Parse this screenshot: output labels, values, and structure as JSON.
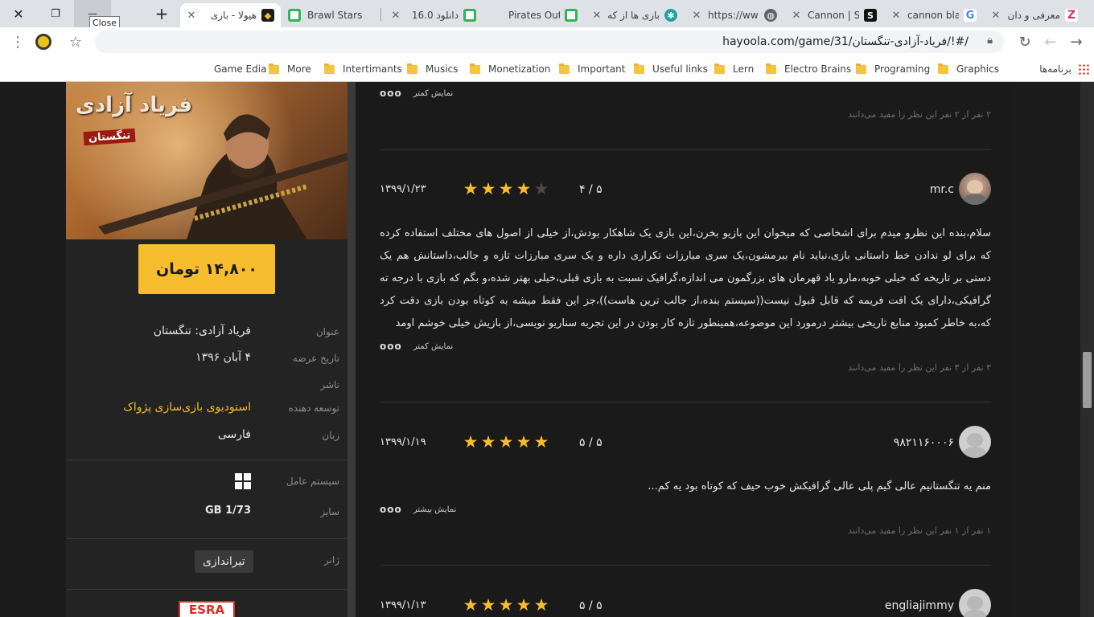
{
  "browser": {
    "window_controls": {
      "close": "✕",
      "restore": "❐",
      "minimize": "—",
      "new_tab": "+"
    },
    "tooltip": "Close",
    "tabs": [
      {
        "title": "هیولا - بازی",
        "icon": "hayoola-favicon",
        "active": true
      },
      {
        "title": "Brawl Stars",
        "icon": "d-favicon"
      },
      {
        "title": "دانلود 16.0",
        "icon": "d-favicon"
      },
      {
        "title": "Pirates Out",
        "icon": "d-favicon"
      },
      {
        "title": "بازی ها از که",
        "icon": "gear-favicon"
      },
      {
        "title": "https://ww",
        "icon": "globe-icon"
      },
      {
        "title": "Cannon | Sc",
        "icon": "s-favicon"
      },
      {
        "title": "cannon bla",
        "icon": "google-icon"
      },
      {
        "title": "معرفی و دان",
        "icon": "z-favicon"
      }
    ],
    "url": "hayoola.com/game/31/فریاد-آزادی-تنگستان/!#/",
    "bookmarks": [
      "برنامه‌ها",
      "Graphics",
      "Programing",
      "Electro Brains",
      "Lern",
      "Useful links",
      "Important",
      "Monetization",
      "Musics",
      "Intertimants",
      "More",
      "Game Edia"
    ]
  },
  "game": {
    "cover_title": "فریاد آزادی",
    "cover_subtitle": "تنگستان",
    "price": "۱۴,۸۰۰ تومان",
    "info": [
      {
        "label": "عنوان",
        "value": "فریاد آزادی: تنگستان"
      },
      {
        "label": "تاریخ عرضه",
        "value": "۴ آبان ۱۳۹۶"
      },
      {
        "label": "ناشر",
        "value": ""
      },
      {
        "label": "توسعه دهنده",
        "value": "استودیوی بازی‌سازی پژواک"
      },
      {
        "label": "زبان",
        "value": "فارسی"
      }
    ],
    "os_label": "سیستم عامل",
    "size_label": "سایز",
    "size_value": "1/73 GB",
    "genre_label": "ژانر",
    "genre": "تیراندازی",
    "rating_logo": "ESRA"
  },
  "reviews": {
    "dots": "ooo",
    "top_more": "نمایش کمتر",
    "top_helpful": "۲ نفر از ۲ نفر این نظر را مفید می‌دانند",
    "items": [
      {
        "user": "mr.c",
        "score": "۴ / ۵",
        "stars": 4,
        "date": "۱۳۹۹/۱/۲۳",
        "text": "سلام،بنده این نظرو میدم برای اشخاصی که میخوان این بازیو بخرن،این بازی یک شاهکار بودش،از خیلی از اصول های مختلف استفاده کرده که برای لو ندادن خط داستانی بازی،نباید نام ببرمشون،یک سری مبارزات تکراری داره و یک سری مبارزات تازه و جالب،داستانش هم یک دستی بر تاریخه که خیلی خوبه،مارو یاد قهرمان های بزرگمون می اندازه،گرافیک نسبت به بازی قبلی،خیلی بهتر شده،و بگم که بازی با درجه ته گرافیکی،دارای یک افت فریمه که قابل قبول نیست((سیستم بنده،از جالب ترین هاست))،جز این فقط میشه به کوتاه بودن بازی دقت کرد که،به خاطر کمبود منابع تاریخی بیشتر درمورد این موضوعه،همینطور تازه کار بودن در این تجربه سناریو نویسی،از بازیش خیلی خوشم اومد",
        "more": "نمایش کمتر",
        "helpful": "۳ نفر از ۳ نفر این نظر را مفید می‌دانند"
      },
      {
        "user": "۹۸۲۱۱۶۰۰۰۶",
        "score": "۵ / ۵",
        "stars": 5,
        "date": "۱۳۹۹/۱/۱۹",
        "text": "منم یه تنگستانیم عالی گیم پلی عالی گرافیکش خوب حیف که کوتاه بود یه کم...",
        "more": "نمایش بیشتر",
        "helpful": "۱ نفر از ۱ نفر این نظر را مفید می‌دانند"
      },
      {
        "user": "engliajimmy",
        "score": "۵ / ۵",
        "stars": 5,
        "date": "۱۳۹۹/۱/۱۳"
      }
    ]
  },
  "colors": {
    "accent": "#f6bd2f",
    "page_bg": "#1c1c1c",
    "panel_bg": "#232323",
    "star_off": "#4a4a4a"
  }
}
